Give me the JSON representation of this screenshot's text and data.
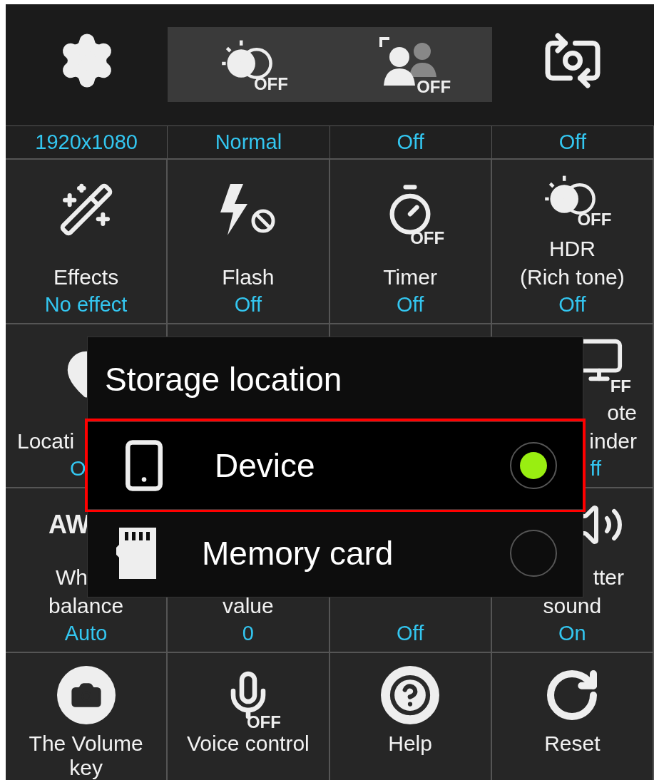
{
  "top_bar": [
    {
      "kind": "settings",
      "value": "1920x1080",
      "highlighted": false
    },
    {
      "kind": "hdr",
      "badge": "OFF",
      "value": "Normal",
      "highlighted": true
    },
    {
      "kind": "face",
      "badge": "OFF",
      "value": "Off",
      "highlighted": true
    },
    {
      "kind": "switch_camera",
      "value": "Off",
      "highlighted": false
    }
  ],
  "grid": [
    {
      "kind": "effects",
      "label": [
        "Effects"
      ],
      "value": "No effect"
    },
    {
      "kind": "flash",
      "label": [
        "Flash"
      ],
      "value": "Off"
    },
    {
      "kind": "timer",
      "badge": "OFF",
      "label": [
        "Timer"
      ],
      "value": "Off"
    },
    {
      "kind": "hdr",
      "badge": "OFF",
      "label": [
        "HDR",
        "(Rich tone)"
      ],
      "value": "Off"
    },
    {
      "kind": "location",
      "label": [
        "Locati"
      ],
      "value": "O"
    },
    {
      "kind": "covered"
    },
    {
      "kind": "covered"
    },
    {
      "kind": "remote",
      "badge": "FF",
      "label": [
        "ote",
        "inder"
      ],
      "value": "ff"
    },
    {
      "kind": "white_balance",
      "badge": "AW",
      "label": [
        "Wh",
        "balance"
      ],
      "value": "Auto"
    },
    {
      "kind": "covered",
      "label": [
        "value"
      ],
      "value": "0"
    },
    {
      "kind": "covered",
      "value": "Off"
    },
    {
      "kind": "shutter",
      "label": [
        "tter",
        "sound"
      ],
      "value": "On"
    },
    {
      "kind": "volume_key",
      "label": [
        "The Volume",
        "key"
      ]
    },
    {
      "kind": "voice",
      "badge": "OFF",
      "label": [
        "Voice control"
      ]
    },
    {
      "kind": "help",
      "label": [
        "Help"
      ]
    },
    {
      "kind": "reset",
      "label": [
        "Reset"
      ]
    }
  ],
  "dialog": {
    "title": "Storage location",
    "options": [
      {
        "kind": "device",
        "label": "Device",
        "selected": true,
        "highlighted": true
      },
      {
        "kind": "memory_card",
        "label": "Memory card",
        "selected": false,
        "highlighted": false
      }
    ]
  }
}
